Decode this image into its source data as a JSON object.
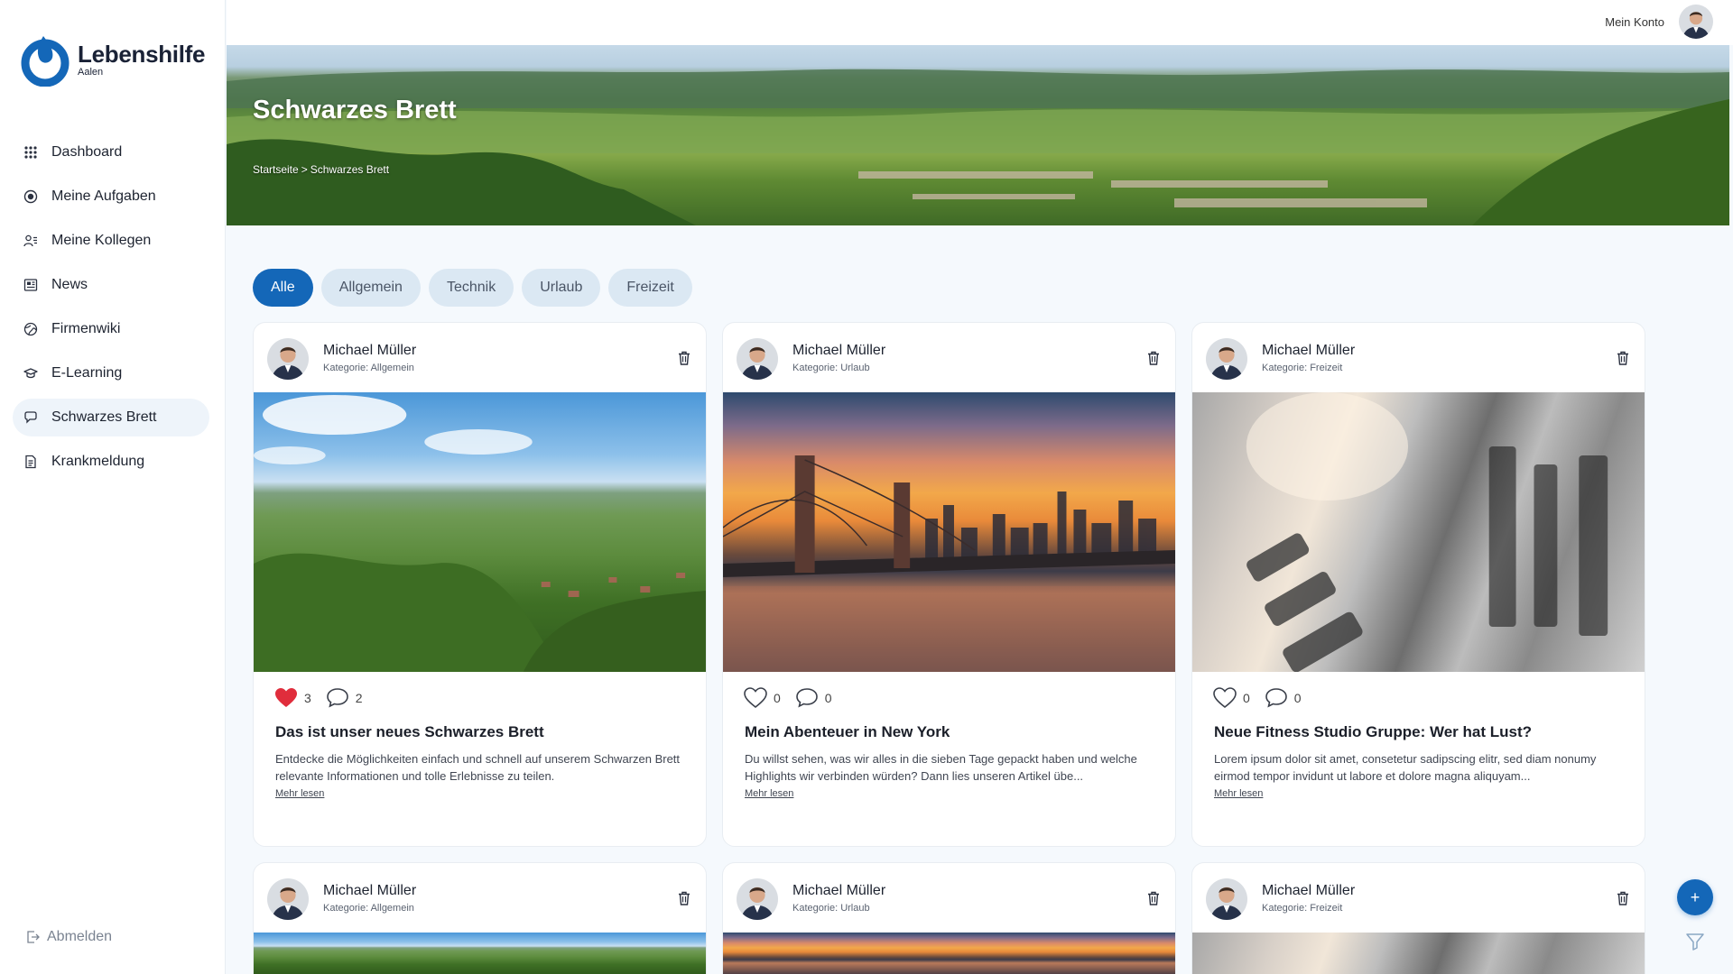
{
  "brand": {
    "name": "Lebenshilfe",
    "sub": "Aalen",
    "color": "#1467b8"
  },
  "sidebar": {
    "items": [
      {
        "label": "Dashboard",
        "icon": "grid-icon"
      },
      {
        "label": "Meine Aufgaben",
        "icon": "target-icon"
      },
      {
        "label": "Meine Kollegen",
        "icon": "users-icon"
      },
      {
        "label": "News",
        "icon": "newspaper-icon"
      },
      {
        "label": "Firmenwiki",
        "icon": "globe-icon"
      },
      {
        "label": "E-Learning",
        "icon": "graduation-cap-icon"
      },
      {
        "label": "Schwarzes Brett",
        "icon": "chat-icon",
        "active": true
      },
      {
        "label": "Krankmeldung",
        "icon": "document-icon"
      }
    ],
    "logout": "Abmelden"
  },
  "topbar": {
    "account_label": "Mein Konto"
  },
  "hero": {
    "title": "Schwarzes Brett",
    "breadcrumb": [
      "Startseite",
      ">",
      "Schwarzes Brett"
    ]
  },
  "filters": [
    "Alle",
    "Allgemein",
    "Technik",
    "Urlaub",
    "Freizeit"
  ],
  "active_filter": "Alle",
  "cards": [
    {
      "author": "Michael Müller",
      "category": "Kategorie: Allgemein",
      "image": "landscape",
      "liked": true,
      "likes": "3",
      "comments": "2",
      "title": "Das ist unser neues Schwarzes Brett",
      "text": "Entdecke die Möglichkeiten einfach und schnell auf unserem Schwarzen Brett relevante Informationen und tolle Erlebnisse zu teilen.",
      "more": "Mehr lesen"
    },
    {
      "author": "Michael Müller",
      "category": "Kategorie: Urlaub",
      "image": "city",
      "liked": false,
      "likes": "0",
      "comments": "0",
      "title": "Mein Abenteuer in New York",
      "text": "Du willst sehen, was wir alles in die sieben Tage gepackt haben und welche Highlights wir verbinden würden? Dann lies unseren Artikel übe...",
      "more": "Mehr lesen"
    },
    {
      "author": "Michael Müller",
      "category": "Kategorie: Freizeit",
      "image": "gym",
      "liked": false,
      "likes": "0",
      "comments": "0",
      "title": "Neue Fitness Studio Gruppe: Wer hat Lust?",
      "text": "Lorem ipsum dolor sit amet, consetetur sadipscing elitr, sed diam nonumy eirmod tempor invidunt ut labore et dolore magna aliquyam...",
      "more": "Mehr lesen"
    },
    {
      "author": "Michael Müller",
      "category": "Kategorie: Allgemein",
      "image": "landscape"
    },
    {
      "author": "Michael Müller",
      "category": "Kategorie: Urlaub",
      "image": "city"
    },
    {
      "author": "Michael Müller",
      "category": "Kategorie: Freizeit",
      "image": "gym"
    }
  ],
  "fab_label": "+"
}
